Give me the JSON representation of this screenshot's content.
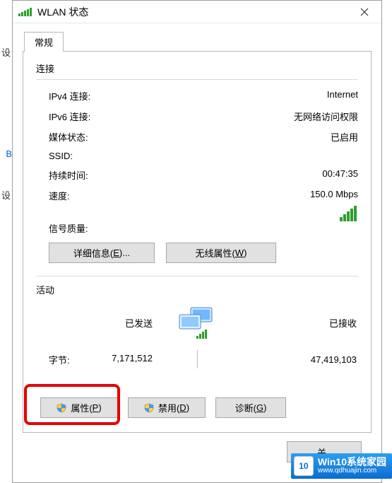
{
  "left_fragments": [
    "设",
    "B",
    "设"
  ],
  "window": {
    "title": "WLAN 状态",
    "tab_general": "常规",
    "section_connection": "连接",
    "section_activity": "活动",
    "rows": {
      "ipv4": {
        "label": "IPv4 连接:",
        "value": "Internet"
      },
      "ipv6": {
        "label": "IPv6 连接:",
        "value": "无网络访问权限"
      },
      "media": {
        "label": "媒体状态:",
        "value": "已启用"
      },
      "ssid": {
        "label": "SSID:",
        "value": ""
      },
      "duration": {
        "label": "持续时间:",
        "value": "00:47:35"
      },
      "speed": {
        "label": "速度:",
        "value": "150.0 Mbps"
      },
      "signal": {
        "label": "信号质量:"
      }
    },
    "buttons": {
      "details": {
        "text": "详细信息(",
        "accel": "E",
        "suffix": ")..."
      },
      "wireless": {
        "text": "无线属性(",
        "accel": "W",
        "suffix": ")"
      },
      "properties": {
        "text": "属性(",
        "accel": "P",
        "suffix": ")"
      },
      "disable": {
        "text": "禁用(",
        "accel": "D",
        "suffix": ")"
      },
      "diagnose": {
        "text": "诊断(",
        "accel": "G",
        "suffix": ")"
      }
    },
    "activity": {
      "sent_label": "已发送",
      "recv_label": "已接收",
      "bytes_label": "字节:",
      "sent": "7,171,512",
      "recv": "47,419,103"
    },
    "close_label_partial": "关闭(C)"
  },
  "watermark": {
    "brand": "Win10系统家园",
    "url": "www.qdhuajin.com",
    "logo": "10"
  }
}
